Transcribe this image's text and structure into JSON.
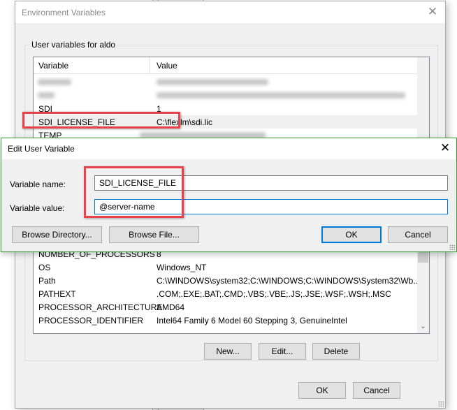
{
  "env_dialog": {
    "title": "Environment Variables",
    "close_icon": "close-icon",
    "group_label": "User variables for aldo",
    "columns": [
      "Variable",
      "Value"
    ],
    "rows": [
      {
        "variable": "",
        "value": "",
        "blurred": true
      },
      {
        "variable": "",
        "value": "",
        "blurred": true
      },
      {
        "variable": "SDI",
        "value": "1"
      },
      {
        "variable": "SDI_LICENSE_FILE",
        "value": "C:\\flexlm\\sdi.lic",
        "selected": true
      },
      {
        "variable": "TEMP",
        "value": "",
        "value_blurred": true
      }
    ],
    "system_rows": [
      {
        "variable": "NUMBER_OF_PROCESSORS",
        "value": "8"
      },
      {
        "variable": "OS",
        "value": "Windows_NT"
      },
      {
        "variable": "Path",
        "value": "C:\\WINDOWS\\system32;C:\\WINDOWS;C:\\WINDOWS\\System32\\Wb..."
      },
      {
        "variable": "PATHEXT",
        "value": ".COM;.EXE;.BAT;.CMD;.VBS;.VBE;.JS;.JSE;.WSF;.WSH;.MSC"
      },
      {
        "variable": "PROCESSOR_ARCHITECTURE",
        "value": "AMD64"
      },
      {
        "variable": "PROCESSOR_IDENTIFIER",
        "value": "Intel64 Family 6 Model 60 Stepping 3, GenuineIntel"
      }
    ],
    "buttons": {
      "new": "New...",
      "edit": "Edit...",
      "delete": "Delete"
    },
    "footer": {
      "ok": "OK",
      "cancel": "Cancel"
    }
  },
  "edit_dialog": {
    "title": "Edit User Variable",
    "close_icon": "close-icon",
    "name_label": "Variable name:",
    "name_value": "SDI_LICENSE_FILE",
    "value_label": "Variable value:",
    "value_value": "@server-name",
    "buttons": {
      "browse_directory": "Browse Directory...",
      "browse_file": "Browse File...",
      "ok": "OK",
      "cancel": "Cancel"
    }
  },
  "colors": {
    "highlight": "#e8434a",
    "focus_blue": "#0078d7",
    "edit_border": "#3c9a3c"
  }
}
